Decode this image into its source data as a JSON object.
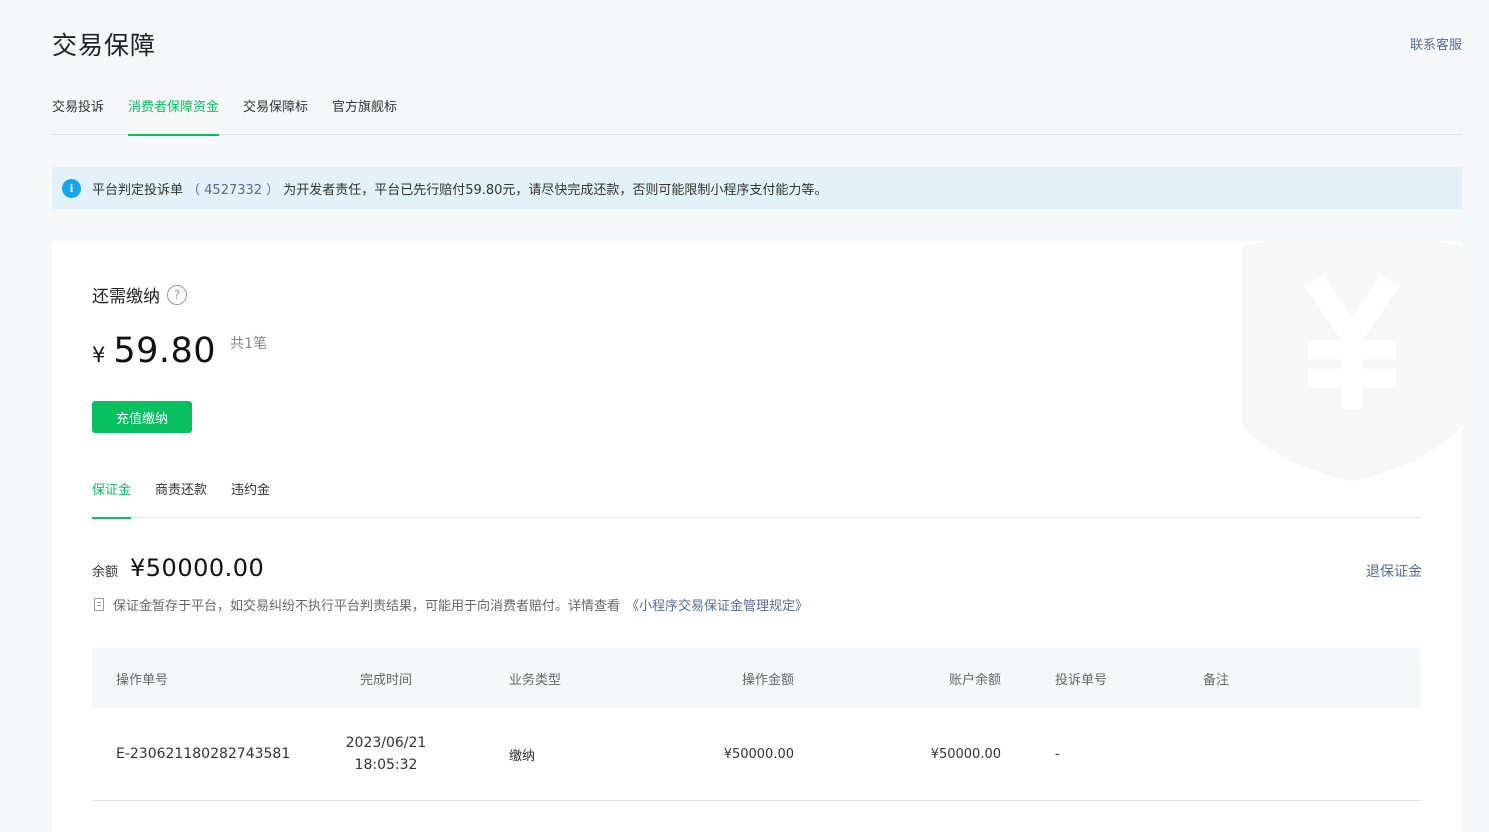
{
  "header": {
    "title": "交易保障",
    "contact_label": "联系客服"
  },
  "tabs": [
    {
      "label": "交易投诉",
      "active": false
    },
    {
      "label": "消费者保障资金",
      "active": true
    },
    {
      "label": "交易保障标",
      "active": false
    },
    {
      "label": "官方旗舰标",
      "active": false
    }
  ],
  "notice": {
    "prefix": "平台判定投诉单",
    "order_no": "（ 4527332 ）",
    "suffix": "为开发者责任，平台已先行赔付59.80元，请尽快完成还款，否则可能限制小程序支付能力等。"
  },
  "due": {
    "label": "还需缴纳",
    "currency": "¥",
    "amount": "59.80",
    "count": "共1笔",
    "pay_button": "充值缴纳"
  },
  "subtabs": [
    {
      "label": "保证金",
      "active": true
    },
    {
      "label": "商责还款",
      "active": false
    },
    {
      "label": "违约金",
      "active": false
    }
  ],
  "deposit": {
    "balance_label": "余额",
    "balance_value": "¥50000.00",
    "refund_label": "退保证金",
    "tip_text": "保证金暂存于平台，如交易纠纷不执行平台判责结果，可能用于向消费者赔付。详情查看",
    "rule_link": "《小程序交易保证金管理规定》"
  },
  "table": {
    "columns": [
      "操作单号",
      "完成时间",
      "业务类型",
      "操作金额",
      "账户余额",
      "投诉单号",
      "备注"
    ],
    "rows": [
      {
        "order_no": "E-230621180282743581",
        "date": "2023/06/21",
        "time": "18:05:32",
        "type": "缴纳",
        "amount": "¥50000.00",
        "balance": "¥50000.00",
        "complaint_no": "-",
        "remark": ""
      }
    ]
  },
  "colors": {
    "accent": "#07c160",
    "link": "#576b95",
    "info": "#1aa3e8",
    "notice_bg": "#e3f1f9"
  }
}
